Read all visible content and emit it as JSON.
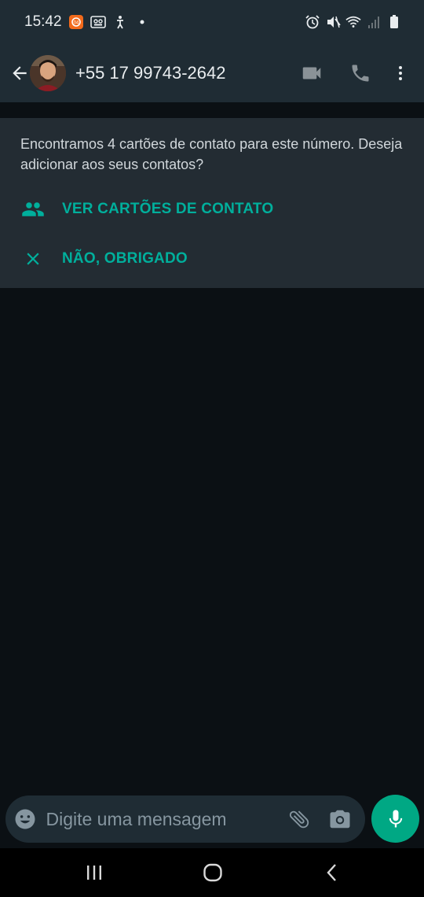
{
  "status_bar": {
    "time": "15:42",
    "left_icons": [
      "notification-app-icon",
      "voicemail-icon",
      "accessibility-icon",
      "dot-icon"
    ],
    "right_icons": [
      "alarm-icon",
      "mute-icon",
      "wifi-icon",
      "signal-icon",
      "battery-icon"
    ]
  },
  "header": {
    "contact_name": "+55 17 99743-2642",
    "icons": [
      "back-arrow-icon",
      "avatar",
      "video-call-icon",
      "phone-icon",
      "more-vert-icon"
    ]
  },
  "contact_card": {
    "message": "Encontramos 4 cartões de contato para este número. Deseja adicionar aos seus contatos?",
    "view_label": "VER CARTÕES DE CONTATO",
    "dismiss_label": "NÃO, OBRIGADO",
    "accent": "#00af9c"
  },
  "composer": {
    "placeholder": "Digite uma mensagem",
    "icons": [
      "emoji-icon",
      "attach-icon",
      "camera-icon",
      "mic-icon"
    ]
  },
  "colors": {
    "background": "#0b1014",
    "bar": "#1f2c34",
    "card": "#232c33",
    "mic_button": "#00a884"
  }
}
